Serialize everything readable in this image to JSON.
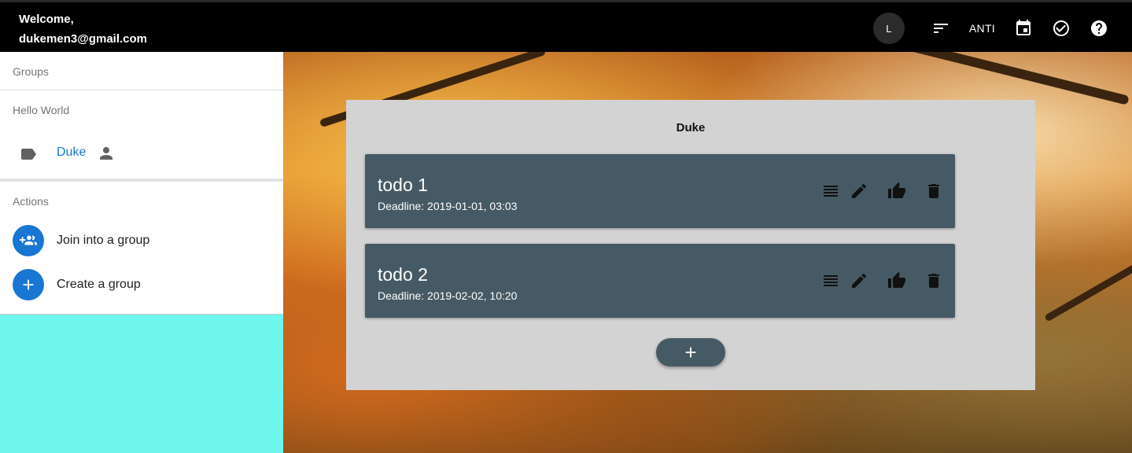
{
  "header": {
    "welcome_line1": "Welcome,",
    "welcome_line2": "dukemen3@gmail.com",
    "avatar_letter": "L",
    "sort_icon": "sort-icon",
    "anti_label": "ANTI",
    "calendar_icon": "calendar-icon",
    "check_icon": "check-circle-icon",
    "help_icon": "help-icon"
  },
  "sidebar": {
    "groups_header": "Groups",
    "group_section": "Hello World",
    "group_item": {
      "name": "Duke",
      "icon": "label-icon",
      "trailing_icon": "person-icon"
    },
    "actions_header": "Actions",
    "actions": [
      {
        "label": "Join into a group",
        "icon": "group-add-icon"
      },
      {
        "label": "Create a group",
        "icon": "plus-icon"
      }
    ]
  },
  "board": {
    "title": "Duke",
    "todos": [
      {
        "title": "todo 1",
        "deadline": "Deadline: 2019-01-01, 03:03"
      },
      {
        "title": "todo 2",
        "deadline": "Deadline: 2019-02-02, 10:20"
      }
    ],
    "todo_actions": [
      "details-icon",
      "edit-icon",
      "like-icon",
      "delete-icon"
    ],
    "add_icon": "plus-icon"
  },
  "colors": {
    "topbar": "#000000",
    "accent": "#1976d2",
    "todo_card": "#455a64",
    "board_bg": "#d3d3d3",
    "sidebar_bg": "#6ff6ec"
  }
}
